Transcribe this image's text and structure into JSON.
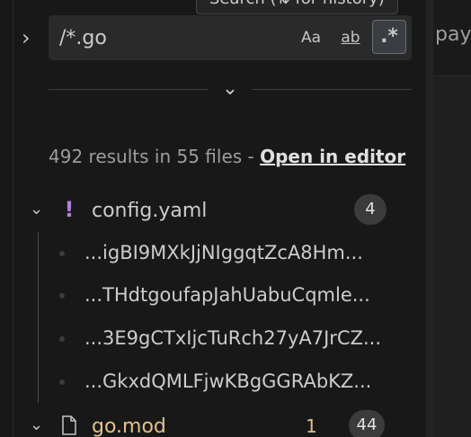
{
  "tooltip": {
    "text": "Search (⇅ for history)"
  },
  "right_pane": {
    "peek_text": "pay"
  },
  "search": {
    "value": "/*.go",
    "options": {
      "match_case": "Aa",
      "whole_word": "ab",
      "regex": ".*"
    }
  },
  "summary": {
    "text": "492 results in 55 files - ",
    "open_in_editor": "Open in editor"
  },
  "files": [
    {
      "name": "config.yaml",
      "icon": "exclamation-icon",
      "count": "4",
      "matches": [
        "...igBI9MXkJjNIggqtZcA8Hm...",
        "...THdtgoufapJahUabuCqmle...",
        "...3E9gCTxIjcTuRch27yA7JrCZ...",
        "...GkxdQMLFjwKBgGGRAbKZ..."
      ]
    },
    {
      "name": "go.mod",
      "icon": "file-icon",
      "problems": "1",
      "count": "44"
    }
  ],
  "colors": {
    "background": "#181818",
    "modified_file": "#e2c08d",
    "warning_icon": "#b180d7",
    "badge": "#3b3b3b"
  }
}
